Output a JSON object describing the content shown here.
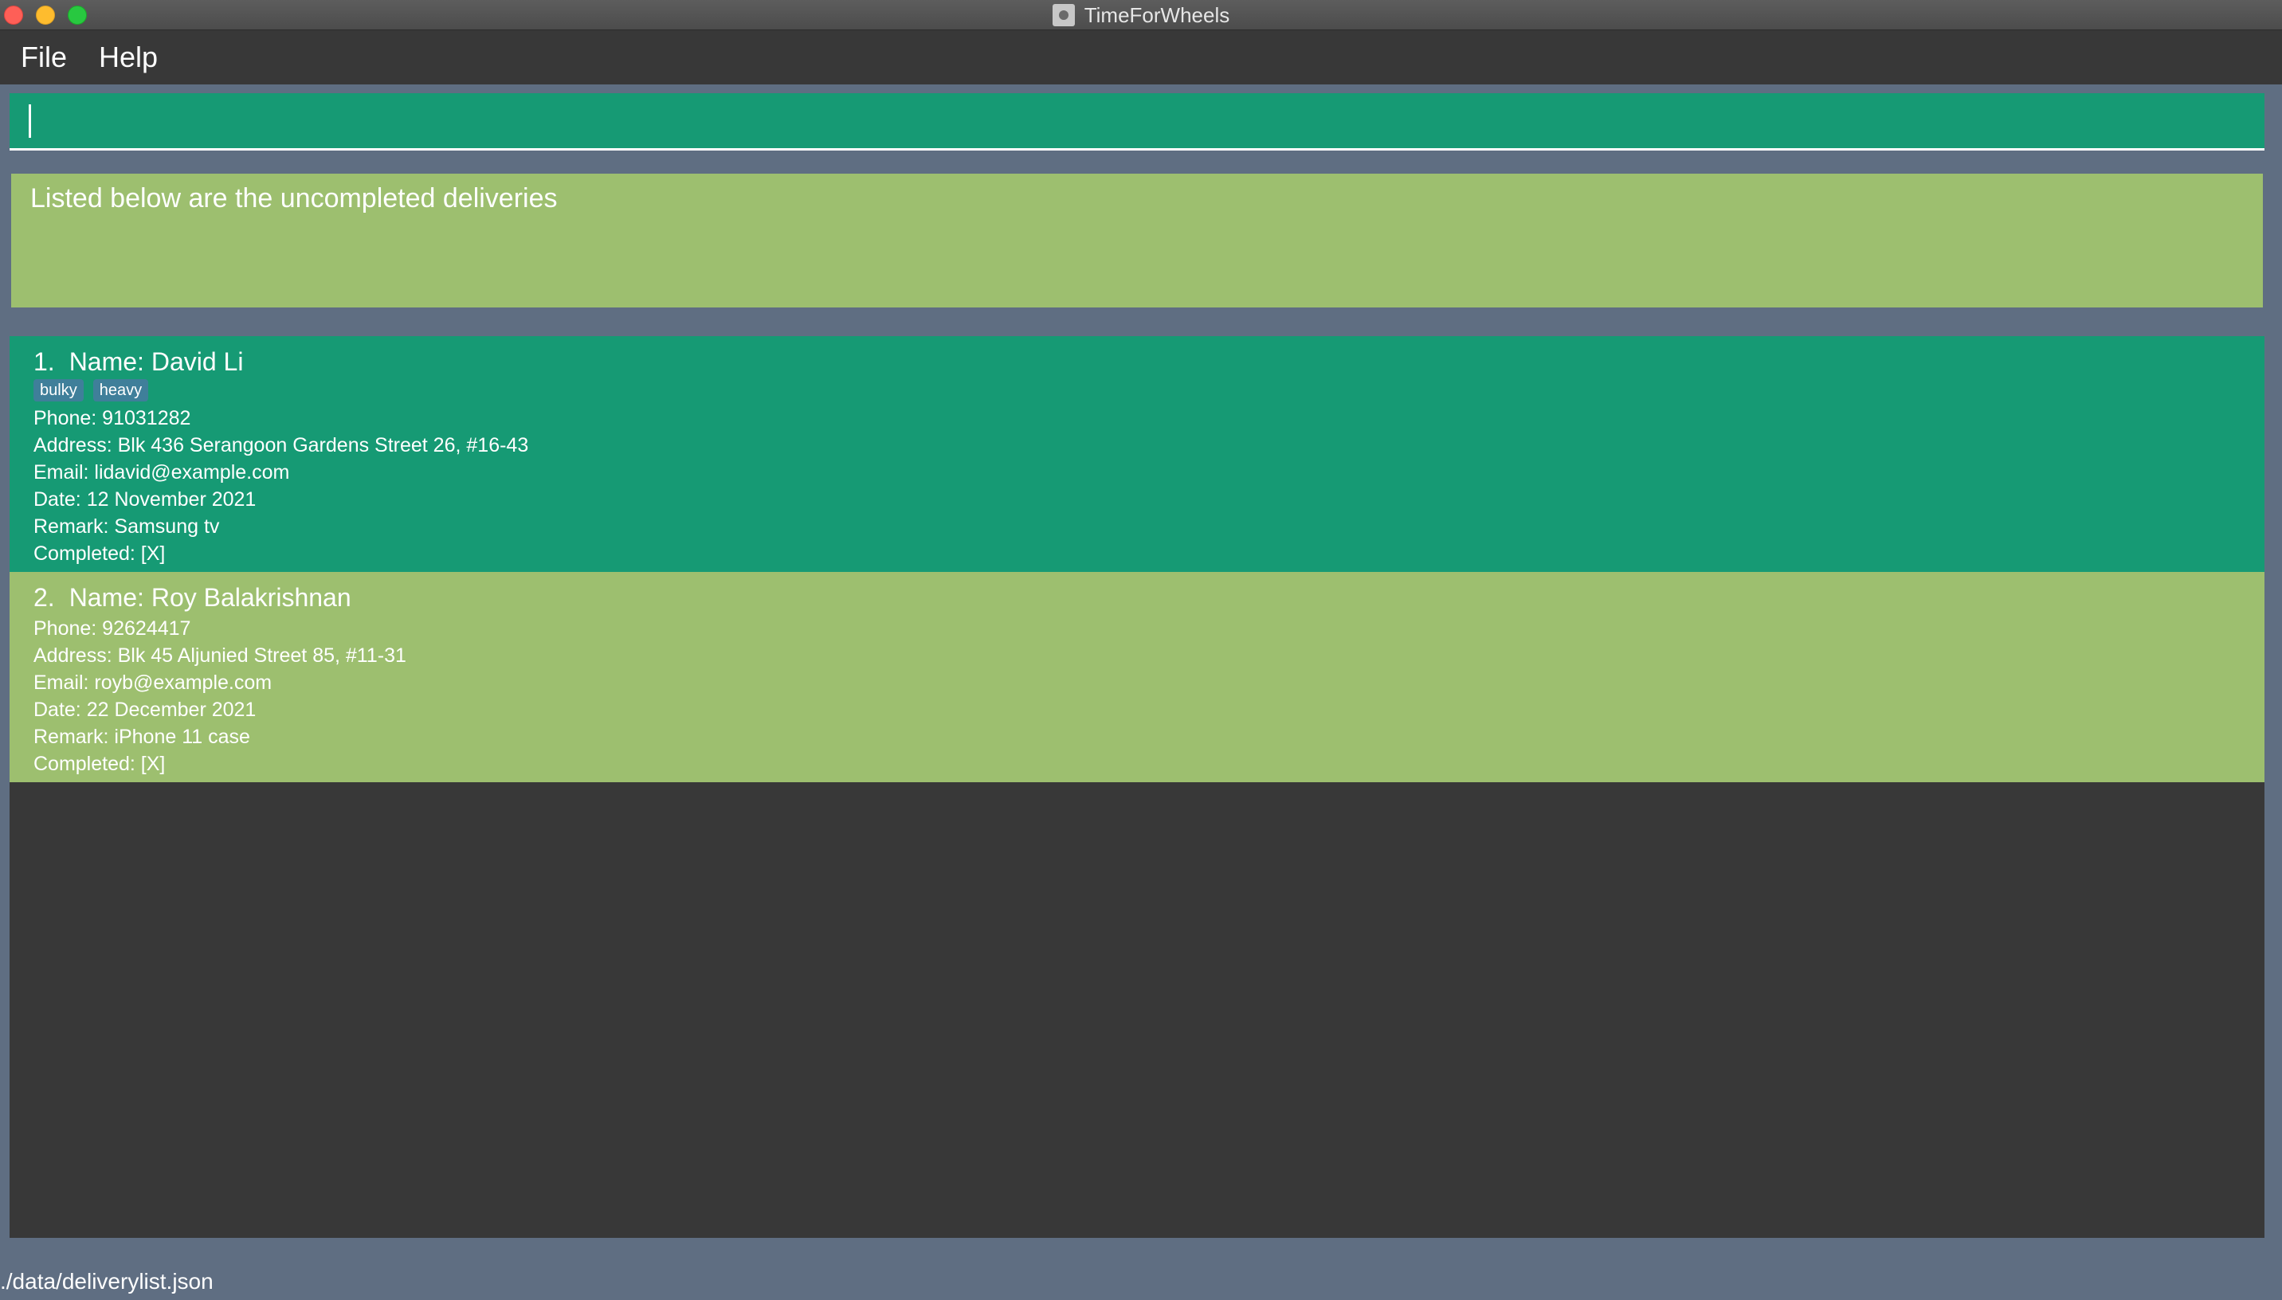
{
  "window": {
    "title": "TimeForWheels"
  },
  "menu": {
    "file": "File",
    "help": "Help"
  },
  "command": {
    "value": ""
  },
  "result": {
    "message": "Listed below are the uncompleted deliveries"
  },
  "deliveries": [
    {
      "index": "1.",
      "name": "Name: David Li",
      "tags": [
        "bulky",
        "heavy"
      ],
      "phone": "Phone: 91031282",
      "address": "Address: Blk 436 Serangoon Gardens Street 26, #16-43",
      "email": "Email: lidavid@example.com",
      "date": "Date: 12 November 2021",
      "remark": "Remark: Samsung tv",
      "completed": "Completed: [X]"
    },
    {
      "index": "2.",
      "name": "Name: Roy Balakrishnan",
      "tags": [],
      "phone": "Phone: 92624417",
      "address": "Address: Blk 45 Aljunied Street 85, #11-31",
      "email": "Email: royb@example.com",
      "date": "Date: 22 December 2021",
      "remark": "Remark: iPhone 11 case",
      "completed": "Completed: [X]"
    }
  ],
  "status": {
    "path": "./data/deliverylist.json"
  },
  "colors": {
    "selected_card": "#169a74",
    "card": "#9dbf6f",
    "panel": "#383838",
    "background": "#5f6e82",
    "tag": "#3f7f9a"
  }
}
